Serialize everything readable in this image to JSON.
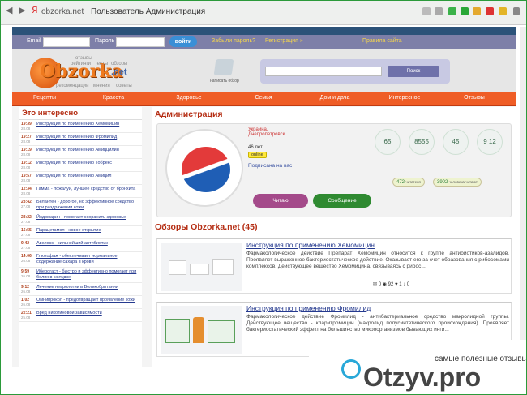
{
  "browser": {
    "host": "obzorka.net",
    "title": "Пользователь Администрация"
  },
  "topbar": {
    "email_label": "Email",
    "password_label": "Пароль",
    "login_button": "войти",
    "forgot": "Забыли пароль?",
    "register": "Регистрация »",
    "rules": "Правила сайта"
  },
  "logo": {
    "text": "Obzorka",
    "suffix": ".net",
    "tags": [
      "отзывы",
      "рейтинги",
      "тесты",
      "обзоры",
      "рекомендации",
      "мнения",
      "советы"
    ]
  },
  "header": {
    "write_review": "написать обзор",
    "search_button": "Поиск"
  },
  "nav": [
    "Рецепты",
    "Красота",
    "Здоровье",
    "Семья",
    "Дом и дача",
    "Интересное",
    "Отзывы"
  ],
  "sidebar": {
    "title": "Это интересно",
    "items": [
      {
        "time": "19:39",
        "date": "28.08",
        "text": "Инструкция по применению Хемомицин"
      },
      {
        "time": "19:27",
        "date": "28.08",
        "text": "Инструкция по применению Фромилид"
      },
      {
        "time": "19:19",
        "date": "28.08",
        "text": "Инструкция по применению Амиццилин"
      },
      {
        "time": "19:12",
        "date": "28.08",
        "text": "Инструкция по применению Тобрекс"
      },
      {
        "time": "19:57",
        "date": "28.08",
        "text": "Инструкция по применению Амицил"
      },
      {
        "time": "12:34",
        "date": "28.08",
        "text": "Гамма - пожалуй, лучшее средство от бронхита"
      },
      {
        "time": "23:42",
        "date": "27.08",
        "text": "Белантен - дорогое, но эффективное средство при раздражении кожи"
      },
      {
        "time": "23:22",
        "date": "27.08",
        "text": "Йодомарин - помогает сохранить здоровье"
      },
      {
        "time": "16:55",
        "date": "27.08",
        "text": "Парацетамол - новое открытие"
      },
      {
        "time": "9:42",
        "date": "27.08",
        "text": "Авелокс - сильнейший антибиотик"
      },
      {
        "time": "14:06",
        "date": "26.08",
        "text": "Глюкофаж - обеспечивает нормальное содержание сахара в крови"
      },
      {
        "time": "9:59",
        "date": "26.08",
        "text": "Иберогаст - быстро и эффективно помогает при болях в желудке"
      },
      {
        "time": "9:12",
        "date": "26.08",
        "text": "Лечение неврологии в Великобритании"
      },
      {
        "time": "1:02",
        "date": "26.08",
        "text": "Омнипрокол - предотвращает проявление кожи"
      },
      {
        "time": "22:21",
        "date": "25.08",
        "text": "Вред никотиновой зависимости"
      }
    ]
  },
  "profile": {
    "heading": "Администрация",
    "country": "Украина,",
    "city": "Днепропетровск",
    "age": "46 лет",
    "online": "online",
    "subscribed": "Подписана на вас",
    "counts": [
      "65",
      "8555",
      "45",
      "9 12"
    ],
    "readers": "472",
    "readers_label": "читателя",
    "people": "3902",
    "people_label": "человека читают",
    "read_button": "Читаю",
    "message_button": "Сообщение"
  },
  "reviews": {
    "heading": "Обзоры Obzorka.net (45)",
    "items": [
      {
        "title": "Инструкция по применению Хемомицин",
        "text": "Фармакологическое действие Препарат Хемомицин относится к группе антибиотиков-азалидов. Проявляет выраженное бактериостатическое действие. Оказывает его за счет образования с рибосомами комплексов. Действующее вещество Хемомицина, связываясь с рибос...",
        "comments": "0",
        "views": "92",
        "likes": "1",
        "dislikes": "0"
      },
      {
        "title": "Инструкция по применению Фромилид",
        "text": "Фармакологическое действие Фромилид - антибактериальное средство макролидной группы. Действующее вещество - кларитромицин (макролид полусинтетического происхождения). Проявляет бактериостатический эффект на большинство микроорганизмов бывающих инги...",
        "comments": "0",
        "views": "33",
        "likes": "0",
        "dislikes": "0"
      }
    ]
  },
  "watermark": {
    "tagline": "самые полезные отзывы",
    "brand": "Otzyv.pro"
  }
}
